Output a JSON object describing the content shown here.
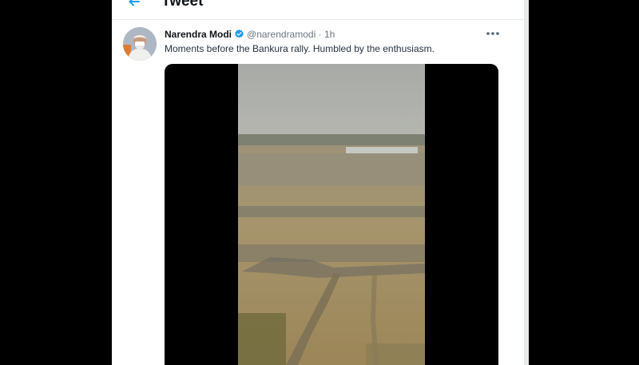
{
  "header": {
    "title": "Tweet"
  },
  "tweet": {
    "author_name": "Narendra Modi",
    "handle": "@narendramodi",
    "separator": "·",
    "time": "1h",
    "text": "Moments before the Bankura rally. Humbled by the enthusiasm."
  },
  "icons": {
    "back": "back-arrow-icon",
    "verified": "verified-badge-icon",
    "more": "more-options-icon"
  },
  "colors": {
    "accent": "#1d9bf0",
    "background": "#000000",
    "panel": "#ffffff",
    "text_primary": "#0f1419",
    "text_secondary": "#6b7680"
  }
}
